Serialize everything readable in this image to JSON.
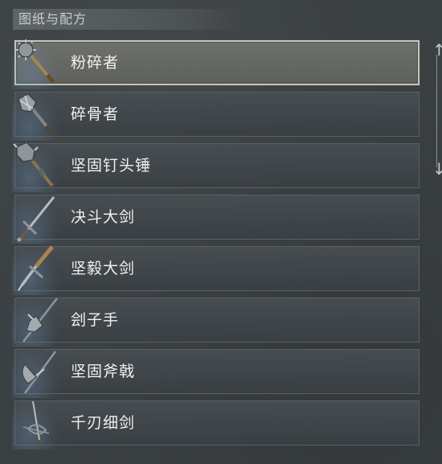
{
  "header": {
    "title": "图纸与配方"
  },
  "items": [
    {
      "label": "粉碎者",
      "icon": "mace-icon",
      "selected": true
    },
    {
      "label": "碎骨者",
      "icon": "flanged-mace-icon",
      "selected": false
    },
    {
      "label": "坚固钉头锤",
      "icon": "morningstar-icon",
      "selected": false
    },
    {
      "label": "决斗大剑",
      "icon": "longsword-icon",
      "selected": false
    },
    {
      "label": "坚毅大剑",
      "icon": "greatsword-icon",
      "selected": false
    },
    {
      "label": "刽子手",
      "icon": "halberd-icon",
      "selected": false
    },
    {
      "label": "坚固斧戟",
      "icon": "poleaxe-icon",
      "selected": false
    },
    {
      "label": "千刃细剑",
      "icon": "rapier-icon",
      "selected": false
    }
  ],
  "scrollbar": {
    "up": "↑",
    "down": "↓"
  }
}
